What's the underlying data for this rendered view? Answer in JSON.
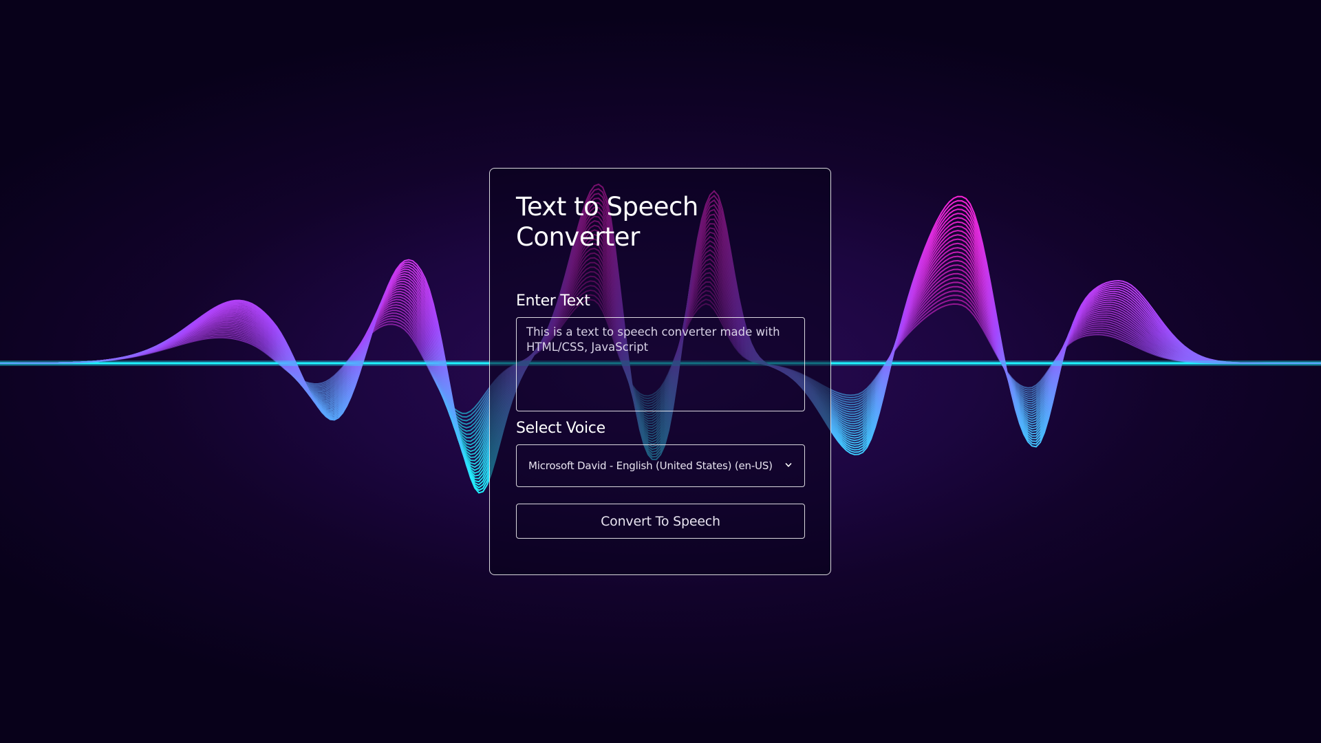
{
  "app": {
    "title_line1": "Text to Speech",
    "title_line2": "Converter"
  },
  "text_input": {
    "label": "Enter Text",
    "value": "This is a text to speech converter made with HTML/CSS, JavaScript"
  },
  "voice_select": {
    "label": "Select Voice",
    "selected": "Microsoft David - English (United States) (en-US)",
    "icon": "chevron-down-icon"
  },
  "convert_button": {
    "label": "Convert To Speech"
  },
  "colors": {
    "background": "#12032b",
    "wave_magenta": "#ff1fd2",
    "wave_cyan": "#1ff4ff",
    "wave_violet": "#a348ff"
  }
}
